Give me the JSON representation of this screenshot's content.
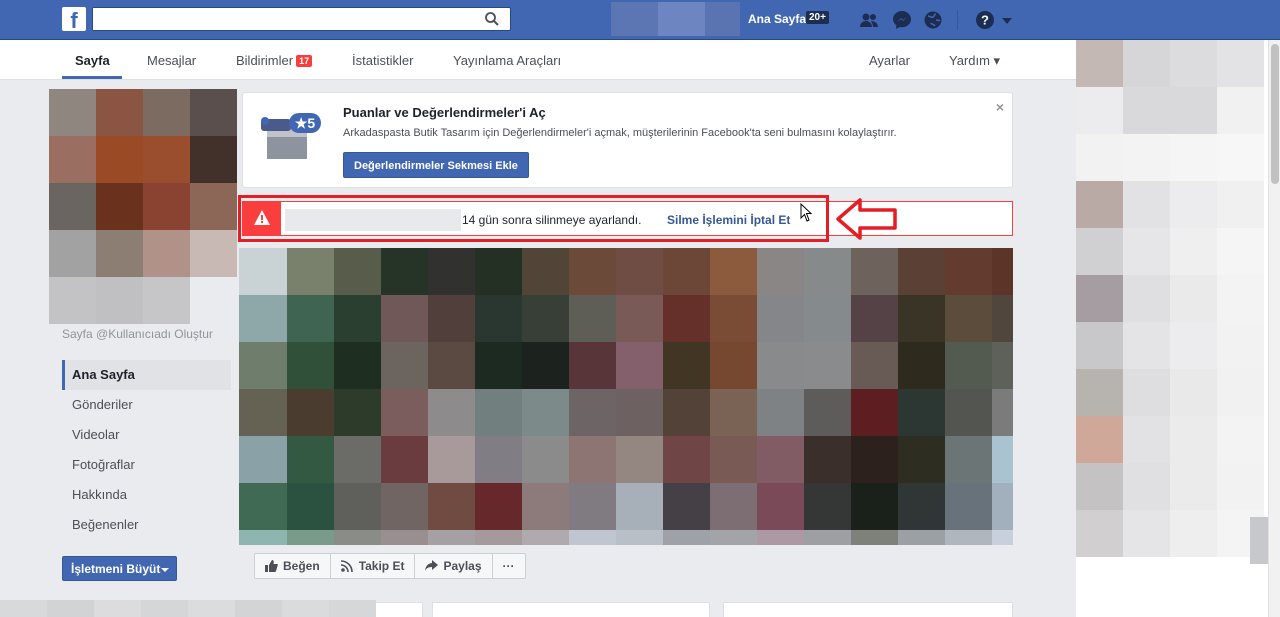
{
  "topbar": {
    "logo": "f",
    "search_placeholder": "",
    "home_label": "Ana Sayfa",
    "home_badge": "20+",
    "icons": [
      "friends-icon",
      "messenger-icon",
      "globe-icon",
      "help-icon",
      "dropdown-icon"
    ]
  },
  "subnav": {
    "tabs": [
      {
        "label": "Sayfa"
      },
      {
        "label": "Mesajlar"
      },
      {
        "label": "Bildirimler",
        "badge": "17"
      },
      {
        "label": "İstatistikler"
      },
      {
        "label": "Yayınlama Araçları"
      }
    ],
    "settings": "Ayarlar",
    "help": "Yardım ▾"
  },
  "left": {
    "username_prompt": "Sayfa @Kullanıcıadı Oluştur",
    "nav": [
      "Ana Sayfa",
      "Gönderiler",
      "Videolar",
      "Fotoğraflar",
      "Hakkında",
      "Beğenenler"
    ],
    "grow_button": "İşletmeni Büyüt"
  },
  "promo": {
    "title": "Puanlar ve Değerlendirmeler'i Aç",
    "description": "Arkadaspasta Butik Tasarım için Değerlendirmeler'i açmak, müşterilerinin Facebook'ta seni bulmasını kolaylaştırır.",
    "button": "Değerlendirmeler Sekmesi Ekle",
    "close": "×",
    "icon_badge": "★5"
  },
  "alert": {
    "message": "14 gün sonra silinmeye ayarlandı.",
    "cancel_link": "Silme İşlemini İptal Et"
  },
  "actions": {
    "like": "Beğen",
    "follow": "Takip Et",
    "share": "Paylaş",
    "more": "···"
  },
  "colors": {
    "brand": "#4267b2",
    "alert_red": "#fa3e3e",
    "annotation_red": "#e31e24"
  }
}
